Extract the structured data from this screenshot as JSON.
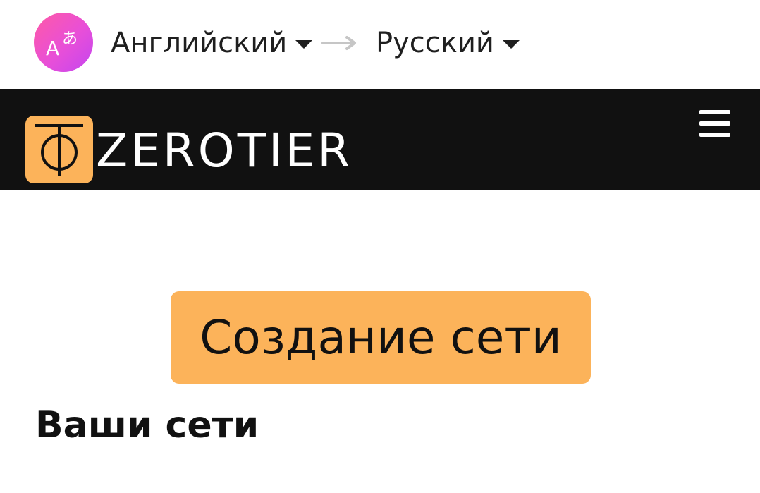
{
  "translate_bar": {
    "source_language": "Английский",
    "target_language": "Русский"
  },
  "header": {
    "logo_text": "ZEROTIER"
  },
  "main": {
    "create_network_label": "Создание сети",
    "section_title": "Ваши сети"
  },
  "colors": {
    "accent": "#fcb35a",
    "header_bg": "#111111",
    "translate_icon_start": "#ff5aa5",
    "translate_icon_end": "#c445f0"
  },
  "icons": {
    "translate": "translate-icon",
    "arrow": "arrow-right-icon",
    "menu": "hamburger-menu-icon",
    "logo": "zerotier-logo-icon"
  }
}
